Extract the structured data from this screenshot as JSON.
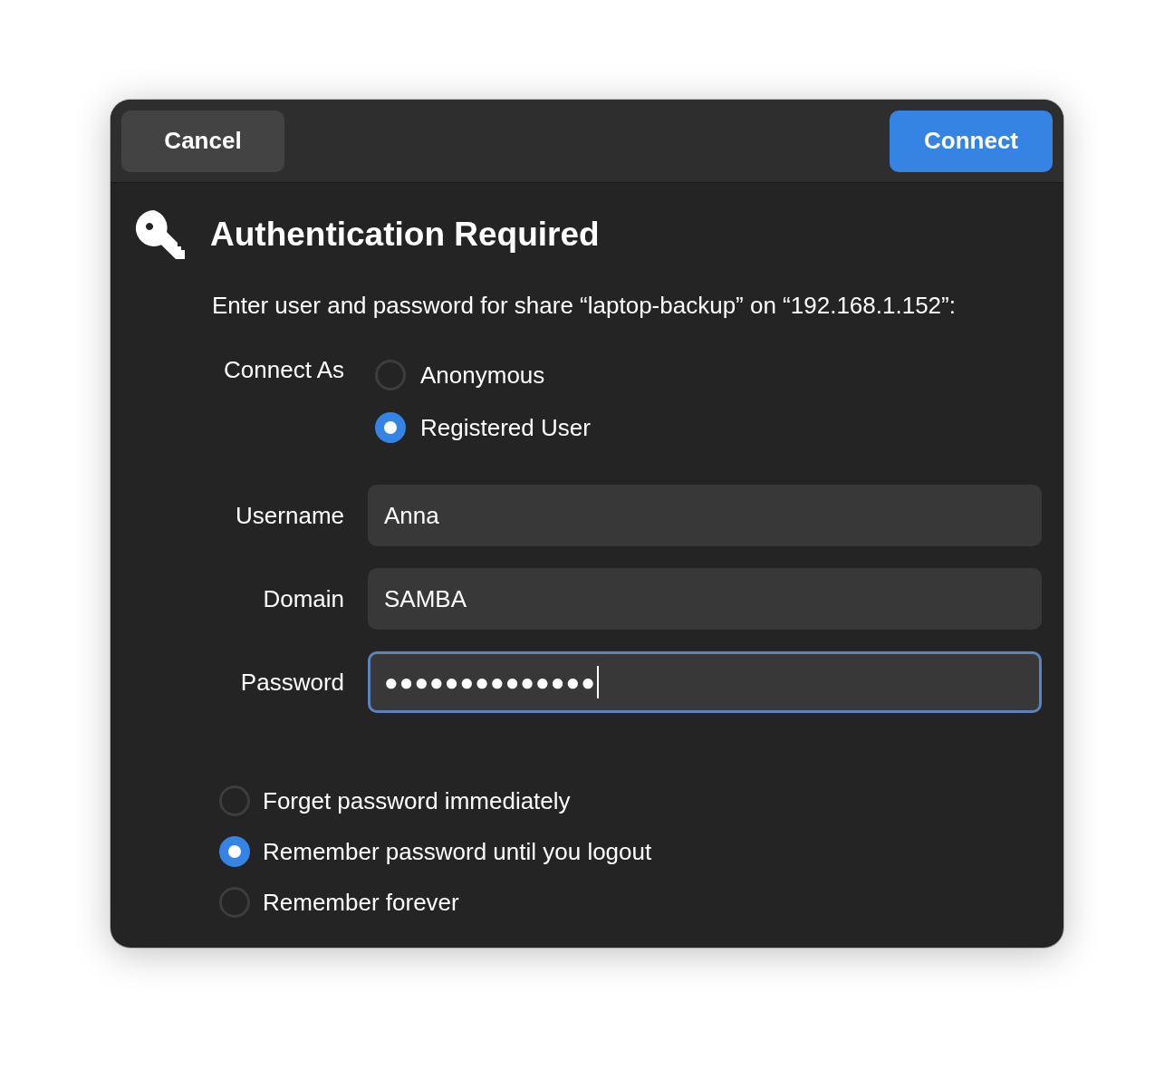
{
  "header": {
    "buttons": [
      {
        "label": "Cancel",
        "kind": "secondary"
      },
      {
        "label": "Connect",
        "kind": "primary"
      }
    ]
  },
  "title": "Authentication Required",
  "message": "Enter user and password for share “laptop-backup” on “192.168.1.152”:",
  "connect_as": {
    "label": "Connect As",
    "options": [
      {
        "label": "Anonymous",
        "selected": false
      },
      {
        "label": "Registered User",
        "selected": true
      }
    ]
  },
  "fields": [
    {
      "label": "Username",
      "value": "Anna",
      "focused": false
    },
    {
      "label": "Domain",
      "value": "SAMBA",
      "focused": false
    },
    {
      "label": "Password",
      "value": "●●●●●●●●●●●●●●",
      "focused": true
    }
  ],
  "remember": [
    {
      "label": "Forget password immediately",
      "selected": false
    },
    {
      "label": "Remember password until you logout",
      "selected": true
    },
    {
      "label": "Remember forever",
      "selected": false
    }
  ]
}
